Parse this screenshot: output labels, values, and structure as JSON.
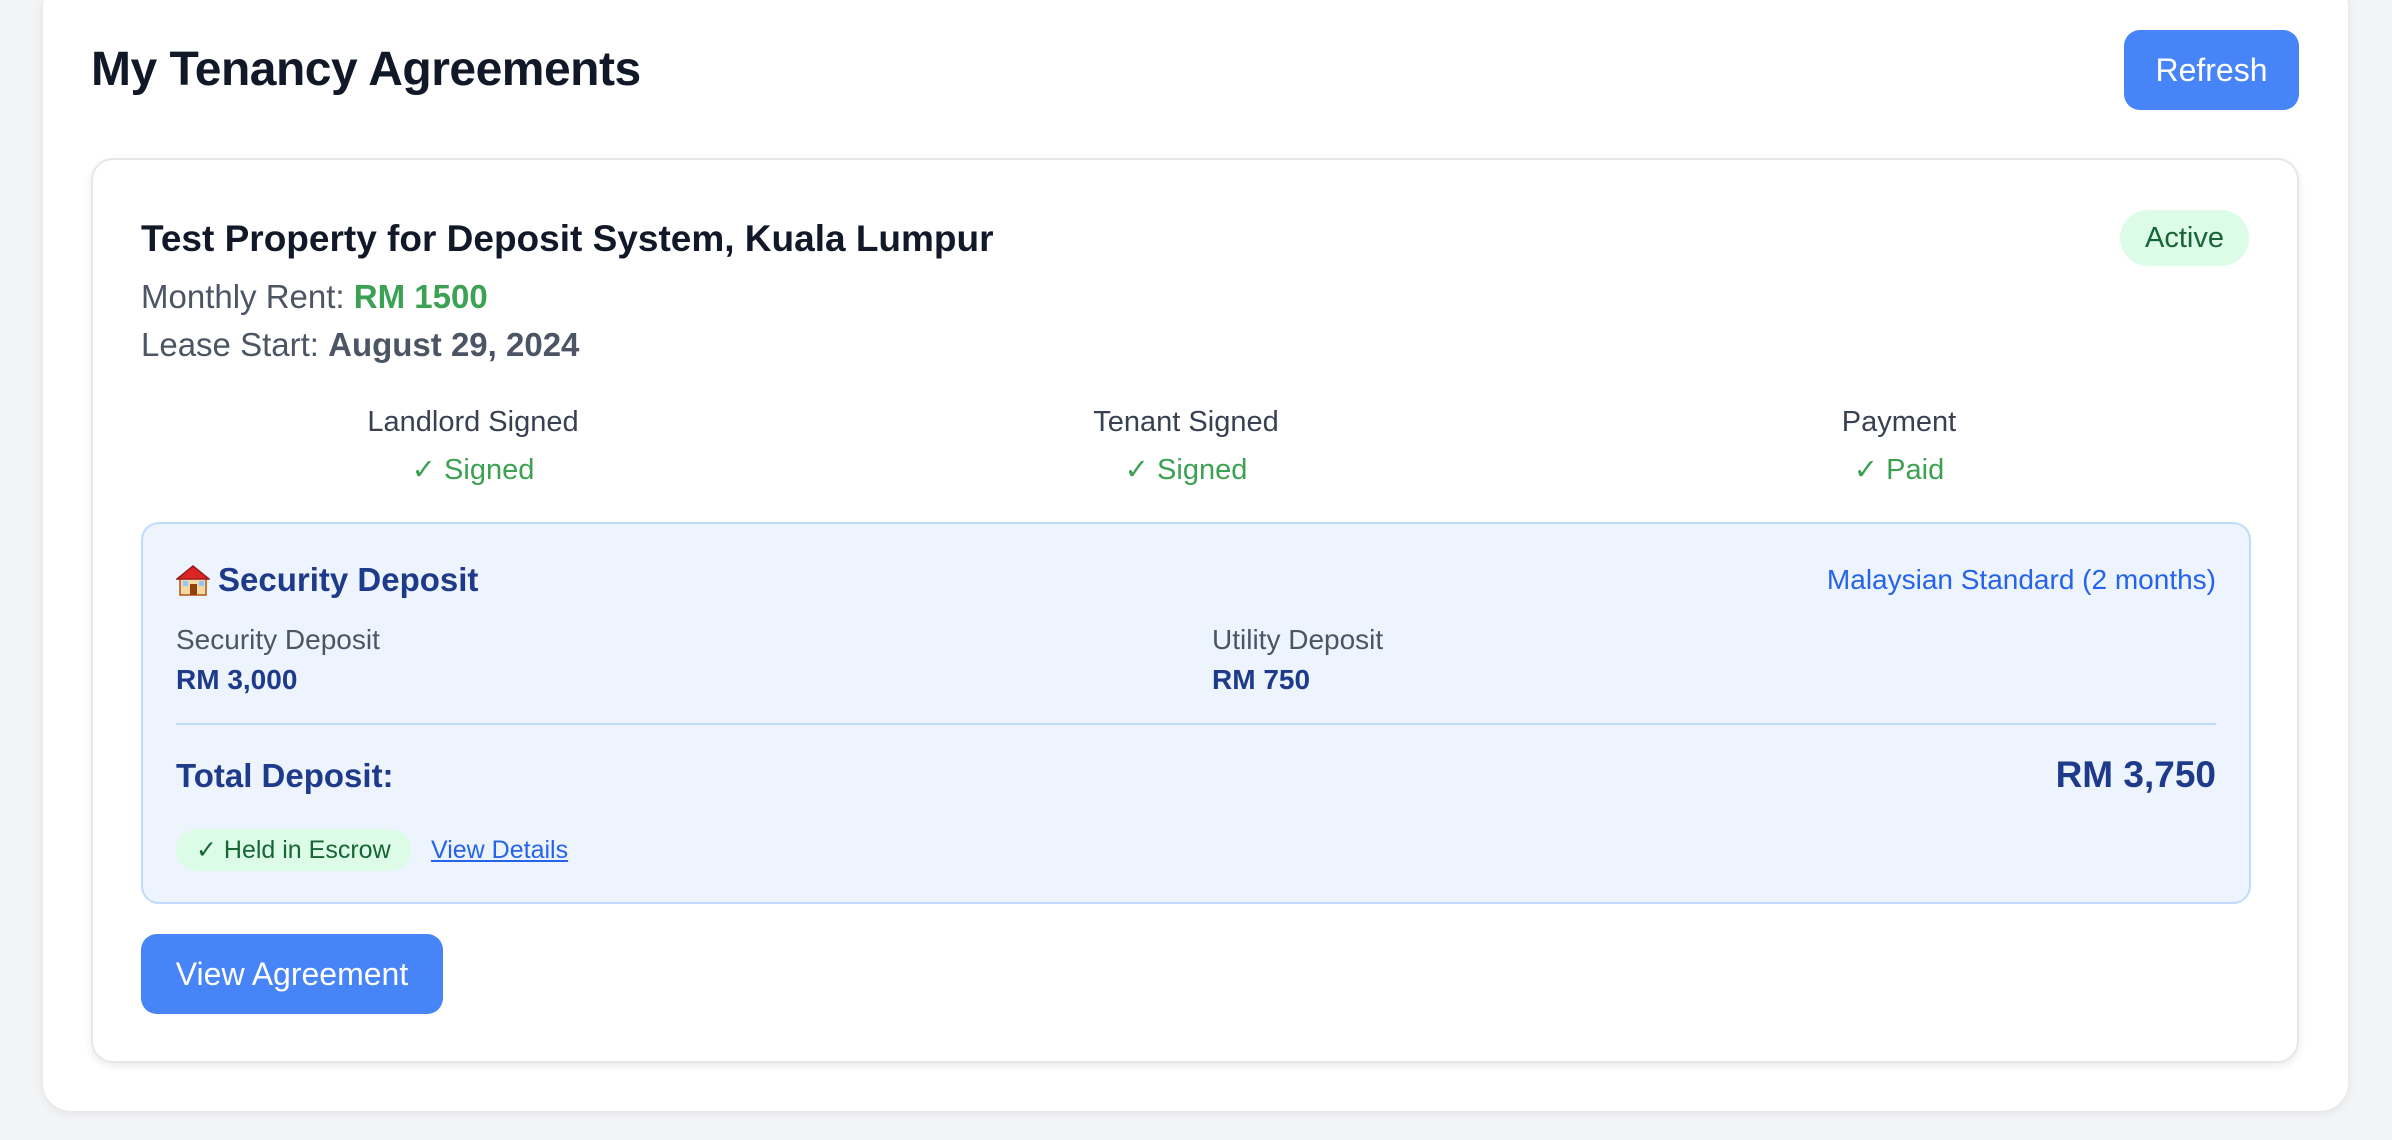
{
  "header": {
    "title": "My Tenancy Agreements",
    "refresh_label": "Refresh"
  },
  "agreement": {
    "property_title": "Test Property for Deposit System, Kuala Lumpur",
    "status": "Active",
    "rent_label": "Monthly Rent:",
    "rent_value": "RM 1500",
    "lease_start_label": "Lease Start:",
    "lease_start_value": "August 29, 2024",
    "signatures": [
      {
        "label": "Landlord Signed",
        "value": "✓ Signed"
      },
      {
        "label": "Tenant Signed",
        "value": "✓ Signed"
      },
      {
        "label": "Payment",
        "value": "✓ Paid"
      }
    ],
    "deposit": {
      "heading": "Security Deposit",
      "standard": "Malaysian Standard (2 months)",
      "security_label": "Security Deposit",
      "security_value": "RM 3,000",
      "utility_label": "Utility Deposit",
      "utility_value": "RM 750",
      "total_label": "Total Deposit:",
      "total_value": "RM 3,750",
      "escrow_status": "✓ Held in Escrow",
      "view_details": "View Details"
    },
    "view_agreement_label": "View Agreement"
  },
  "colors": {
    "primary": "#4684f8",
    "success": "#3ca152",
    "deposit_text": "#1e3a8a",
    "link": "#2563eb"
  },
  "icons": {
    "deposit_heading": "house-icon"
  }
}
